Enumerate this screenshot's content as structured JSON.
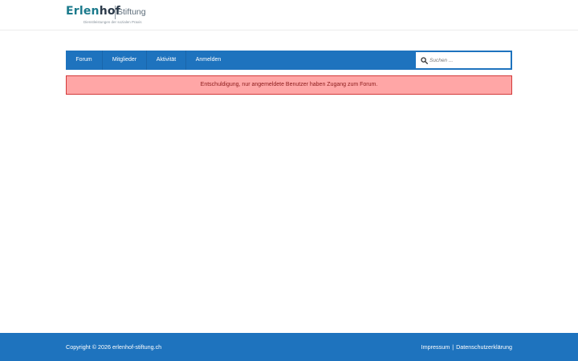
{
  "header": {
    "logo": {
      "name_part1": "Erlen",
      "name_part2": "hof",
      "suffix": "Stiftung",
      "tagline": "Dienstleistungen der sozialen Praxis"
    }
  },
  "nav": {
    "items": [
      {
        "label": "Forum"
      },
      {
        "label": "Mitglieder"
      },
      {
        "label": "Aktivität"
      },
      {
        "label": "Anmelden"
      }
    ],
    "search": {
      "placeholder": "Suchen ..."
    }
  },
  "alert": {
    "message": "Entschuldigung, nur angemeldete Benutzer haben Zugang zum Forum."
  },
  "footer": {
    "copyright": "Copyright © 2026 erlenhof-stiftung.ch",
    "links": [
      {
        "label": "Impressum"
      },
      {
        "label": "Datenschutzerklärung"
      }
    ],
    "separator": "|"
  },
  "colors": {
    "primary": "#1e73be",
    "alert_bg": "#ffa6a6",
    "alert_border": "#d33a3a",
    "alert_text": "#8b1b1b"
  },
  "icons": {
    "search": "search-icon"
  }
}
